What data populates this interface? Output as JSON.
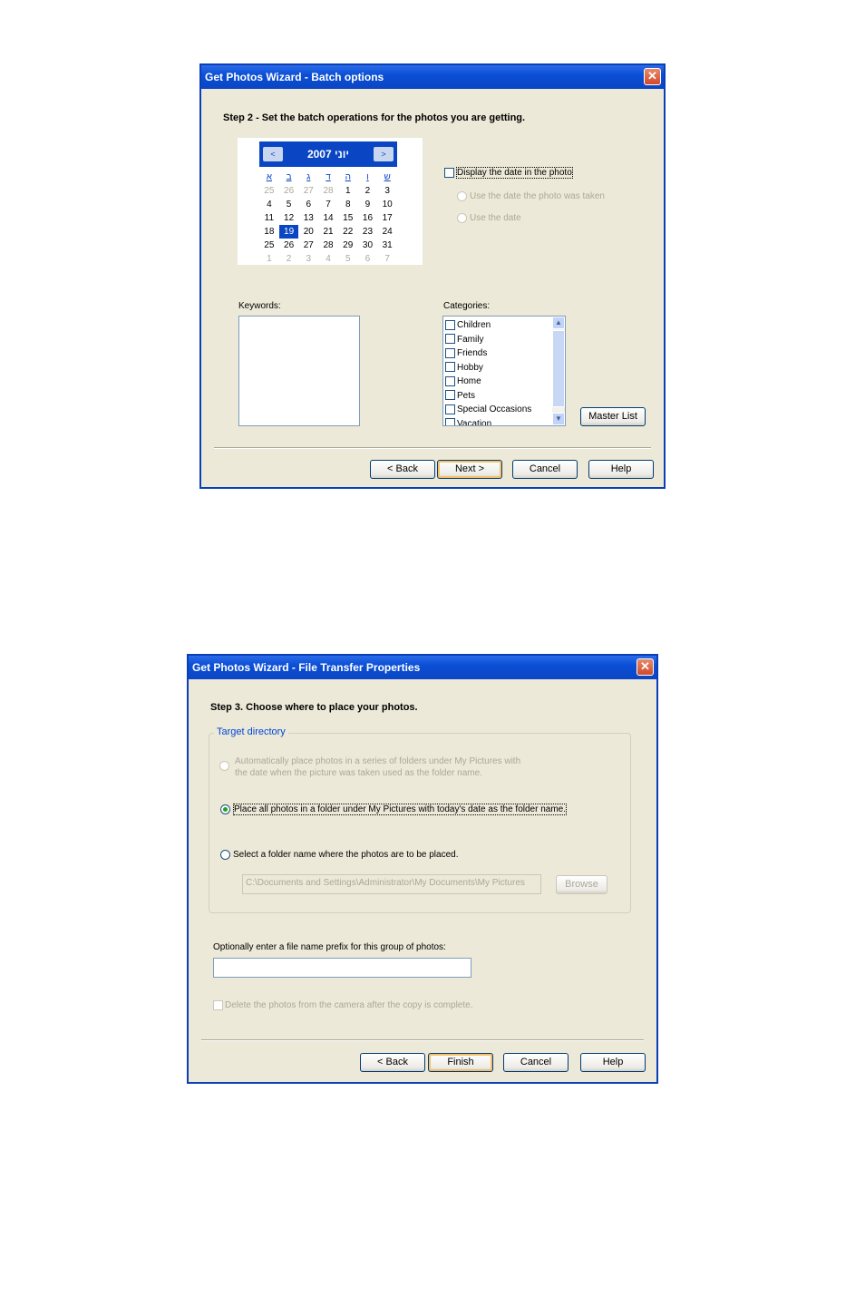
{
  "batch_window": {
    "title": "Get Photos Wizard - Batch options",
    "close_glyph": "✕",
    "step_text": "Step 2 - Set the batch operations for the photos you are getting.",
    "calendar": {
      "prev_glyph": "<",
      "next_glyph": ">",
      "month_title": "2007 יוני",
      "weekdays": [
        "א",
        "ב",
        "ג",
        "ד",
        "ה",
        "ו",
        "ש"
      ],
      "weeks": [
        [
          {
            "d": "25",
            "grey": true
          },
          {
            "d": "26",
            "grey": true
          },
          {
            "d": "27",
            "grey": true
          },
          {
            "d": "28",
            "grey": true
          },
          {
            "d": "1"
          },
          {
            "d": "2"
          },
          {
            "d": "3"
          }
        ],
        [
          {
            "d": "4"
          },
          {
            "d": "5"
          },
          {
            "d": "6"
          },
          {
            "d": "7"
          },
          {
            "d": "8"
          },
          {
            "d": "9"
          },
          {
            "d": "10"
          }
        ],
        [
          {
            "d": "11"
          },
          {
            "d": "12"
          },
          {
            "d": "13"
          },
          {
            "d": "14"
          },
          {
            "d": "15"
          },
          {
            "d": "16"
          },
          {
            "d": "17"
          }
        ],
        [
          {
            "d": "18"
          },
          {
            "d": "19",
            "sel": true
          },
          {
            "d": "20"
          },
          {
            "d": "21"
          },
          {
            "d": "22"
          },
          {
            "d": "23"
          },
          {
            "d": "24"
          }
        ],
        [
          {
            "d": "25"
          },
          {
            "d": "26"
          },
          {
            "d": "27"
          },
          {
            "d": "28"
          },
          {
            "d": "29"
          },
          {
            "d": "30"
          },
          {
            "d": "31"
          }
        ],
        [
          {
            "d": "1",
            "grey": true
          },
          {
            "d": "2",
            "grey": true
          },
          {
            "d": "3",
            "grey": true
          },
          {
            "d": "4",
            "grey": true
          },
          {
            "d": "5",
            "grey": true
          },
          {
            "d": "6",
            "grey": true
          },
          {
            "d": "7",
            "grey": true
          }
        ]
      ]
    },
    "display_date_label": "Display the date in the photo",
    "use_date_taken_label": "Use the date the photo was taken",
    "use_the_date_label": "Use the date",
    "keywords_label": "Keywords:",
    "categories_label": "Categories:",
    "categories": [
      "Children",
      "Family",
      "Friends",
      "Hobby",
      "Home",
      "Pets",
      "Special Occasions",
      "Vacation"
    ],
    "scroll_up_glyph": "▲",
    "scroll_down_glyph": "▼",
    "master_list_label": "Master List",
    "back_label": "< Back",
    "next_label": "Next >",
    "cancel_label": "Cancel",
    "help_label": "Help"
  },
  "transfer_window": {
    "title": "Get Photos Wizard - File Transfer Properties",
    "close_glyph": "✕",
    "step_text": "Step 3. Choose where to place your photos.",
    "group_label": "Target directory",
    "option_auto_line1": "Automatically place photos in a series of folders under My Pictures with",
    "option_auto_line2": "the date when the picture was taken used as the folder name.",
    "option_today_label": "Place all photos in a folder under My Pictures with today's date as the folder name.",
    "option_select_label": "Select a folder name where the photos are to be placed.",
    "folder_path_value": "C:\\Documents and Settings\\Administrator\\My Documents\\My Pictures",
    "browse_label": "Browse",
    "prefix_label": "Optionally enter a file name prefix for this group of photos:",
    "prefix_value": "",
    "delete_label": "Delete the photos from the camera after the copy is complete.",
    "back_label": "< Back",
    "finish_label": "Finish",
    "cancel_label": "Cancel",
    "help_label": "Help"
  }
}
